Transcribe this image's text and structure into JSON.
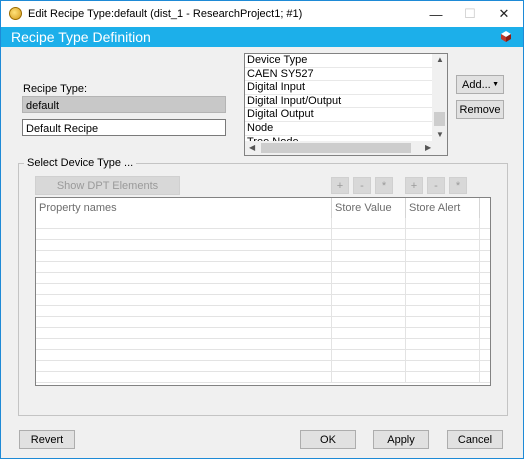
{
  "window": {
    "title": "Edit Recipe Type:default (dist_1 - ResearchProject1; #1)",
    "controls": {
      "minimize": "—",
      "maximize": "☐",
      "close": "✕"
    }
  },
  "header": {
    "title": "Recipe Type Definition",
    "icon": "book-icon"
  },
  "recipe_type": {
    "label": "Recipe Type:",
    "name_value": "default",
    "description_value": "Default Recipe"
  },
  "device_types": {
    "items": [
      "Device Type",
      "CAEN SY527",
      "Digital Input",
      "Digital Input/Output",
      "Digital Output",
      "Node",
      "Tree Node"
    ]
  },
  "buttons": {
    "add": "Add...",
    "add_arrow": "▼",
    "remove": "Remove",
    "show_dpt": "Show DPT Elements",
    "plus": "+",
    "minus": "-",
    "star": "*",
    "revert": "Revert",
    "ok": "OK",
    "apply": "Apply",
    "cancel": "Cancel"
  },
  "group": {
    "label": "Select Device Type ..."
  },
  "table": {
    "columns": [
      "Property names",
      "Store Value",
      "Store Alert"
    ],
    "rows": []
  },
  "colors": {
    "header_bg": "#1cafea",
    "window_bg": "#f0f0f0"
  }
}
